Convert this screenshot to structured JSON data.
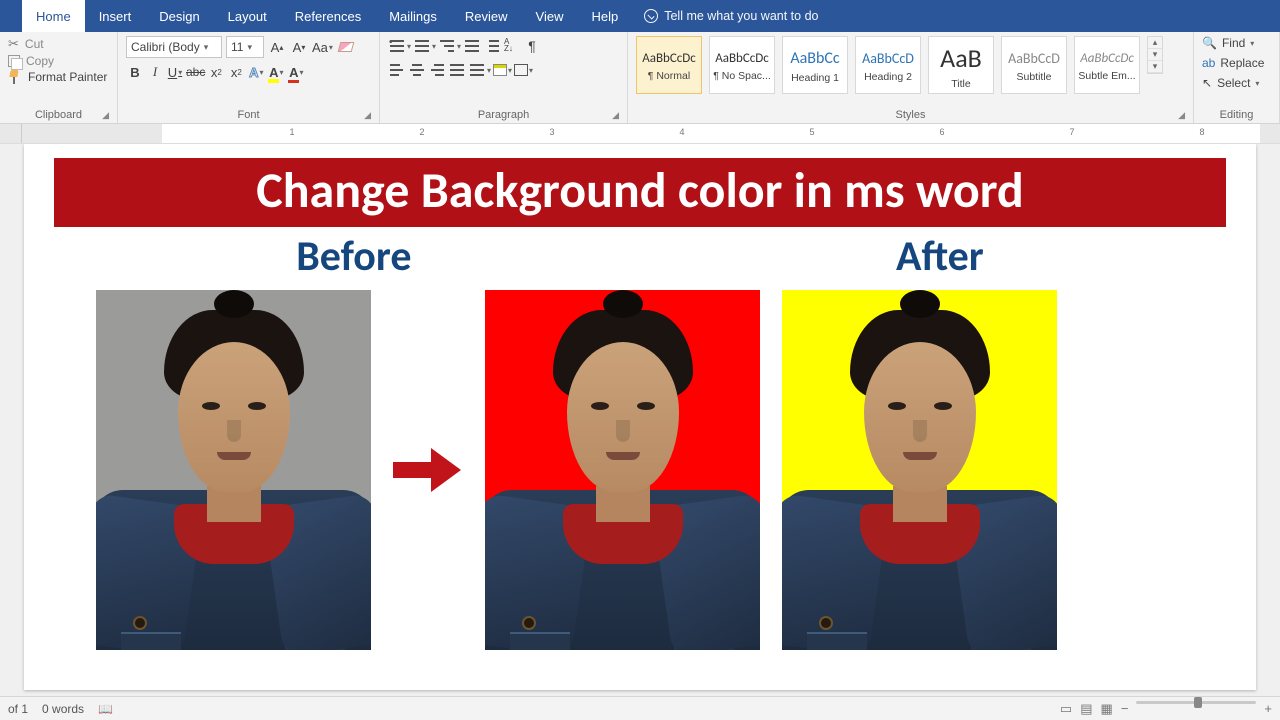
{
  "tabs": {
    "items": [
      "Home",
      "Insert",
      "Design",
      "Layout",
      "References",
      "Mailings",
      "Review",
      "View",
      "Help"
    ],
    "active": "Home",
    "tell_me": "Tell me what you want to do"
  },
  "ribbon": {
    "clipboard": {
      "cut": "Cut",
      "copy": "Copy",
      "format_painter": "Format Painter",
      "label": "Clipboard"
    },
    "font": {
      "name": "Calibri (Body",
      "size": "11",
      "label": "Font"
    },
    "paragraph": {
      "label": "Paragraph"
    },
    "styles": {
      "label": "Styles",
      "items": [
        {
          "sample": "AaBbCcDc",
          "name": "¶ Normal",
          "size": "13px",
          "color": "#333",
          "selected": true
        },
        {
          "sample": "AaBbCcDc",
          "name": "¶ No Spac...",
          "size": "13px",
          "color": "#333"
        },
        {
          "sample": "AaBbCc",
          "name": "Heading 1",
          "size": "16px",
          "color": "#2e74b5"
        },
        {
          "sample": "AaBbCcD",
          "name": "Heading 2",
          "size": "14px",
          "color": "#2e74b5"
        },
        {
          "sample": "AaB",
          "name": "Title",
          "size": "26px",
          "color": "#333"
        },
        {
          "sample": "AaBbCcD",
          "name": "Subtitle",
          "size": "14px",
          "color": "#888"
        },
        {
          "sample": "AaBbCcDc",
          "name": "Subtle Em...",
          "size": "13px",
          "color": "#888",
          "italic": true
        }
      ]
    },
    "editing": {
      "find": "Find",
      "replace": "Replace",
      "select": "Select",
      "label": "Editing"
    }
  },
  "ruler": {
    "numbers": [
      1,
      2,
      3,
      4,
      5,
      6,
      7,
      8
    ]
  },
  "document": {
    "banner": "Change Background color in ms word",
    "before": "Before",
    "after": "After"
  },
  "status": {
    "page": "of 1",
    "words": "0 words"
  }
}
